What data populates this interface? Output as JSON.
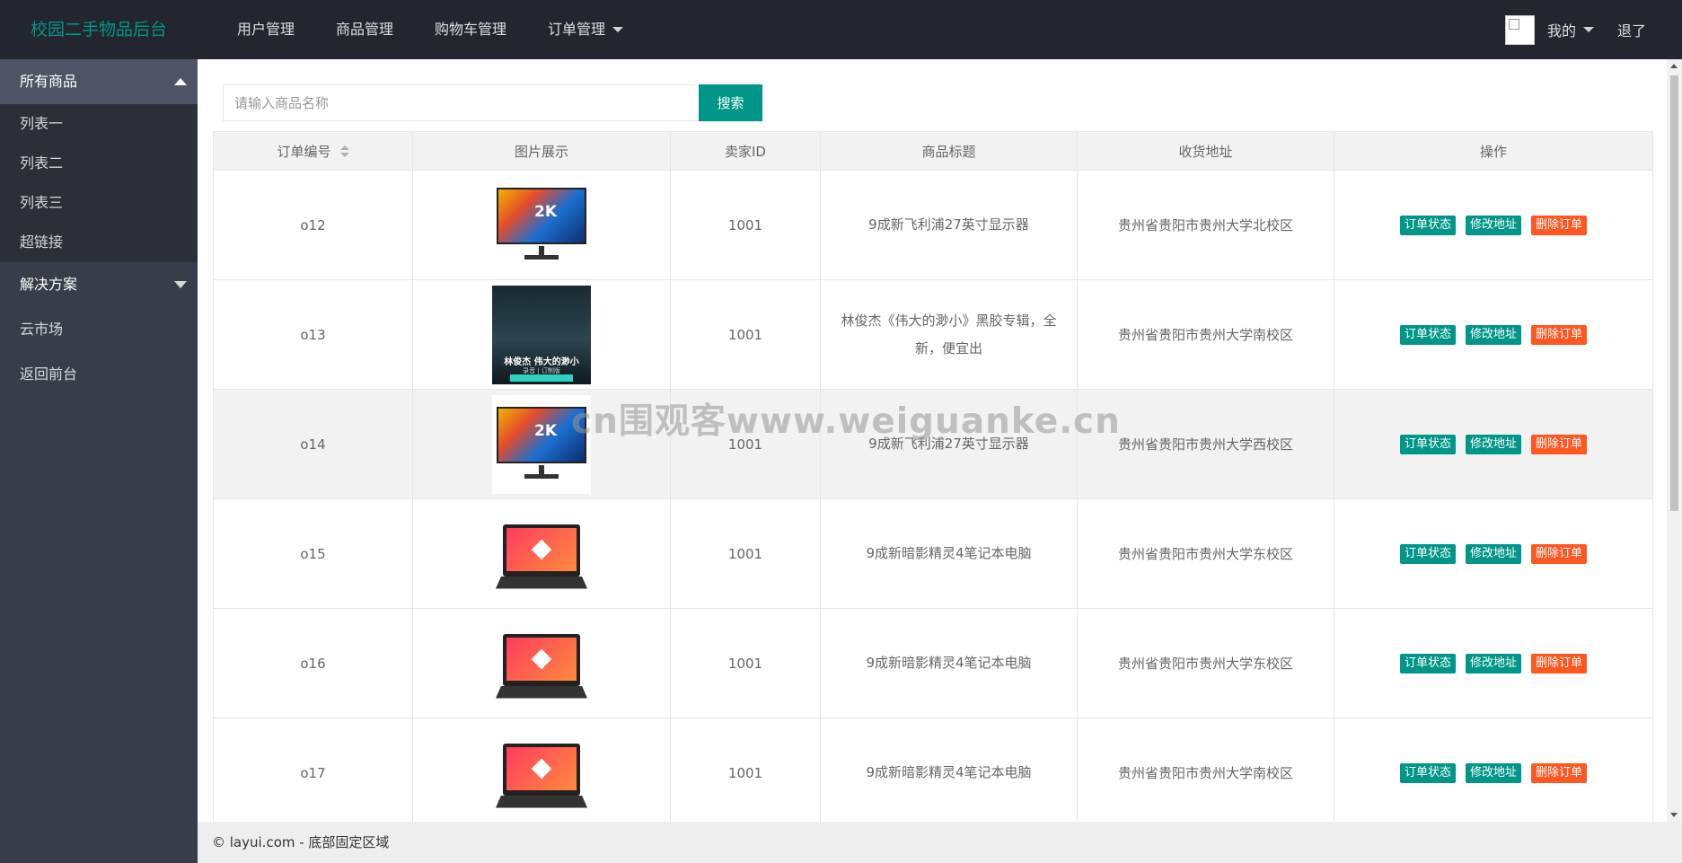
{
  "header": {
    "logo": "校园二手物品后台",
    "nav": [
      "用户管理",
      "商品管理",
      "购物车管理",
      "订单管理"
    ],
    "user_label": "我的",
    "logout_label": "退了"
  },
  "sidebar": {
    "group1_title": "所有商品",
    "group1_items": [
      "列表一",
      "列表二",
      "列表三",
      "超链接"
    ],
    "group2_title": "解决方案",
    "items": [
      "云市场",
      "返回前台"
    ]
  },
  "search": {
    "placeholder": "请输入商品名称",
    "button": "搜索"
  },
  "table": {
    "headers": [
      "订单编号",
      "图片展示",
      "卖家ID",
      "商品标题",
      "收货地址",
      "操作"
    ],
    "actions": [
      "订单状态",
      "修改地址",
      "删除订单"
    ],
    "rows": [
      {
        "id": "o12",
        "image": "monitor-image",
        "badge": "2K",
        "seller": "1001",
        "title": "9成新飞利浦27英寸显示器",
        "address": "贵州省贵阳市贵州大学北校区"
      },
      {
        "id": "o13",
        "image": "album-image",
        "album_title": "林俊杰 伟大的渺小",
        "album_sub": "录音 | 订制版",
        "seller": "1001",
        "title": "林俊杰《伟大的渺小》黑胶专辑，全新，便宜出",
        "address": "贵州省贵阳市贵州大学南校区"
      },
      {
        "id": "o14",
        "image": "monitor-image",
        "badge": "2K",
        "seller": "1001",
        "title": "9成新飞利浦27英寸显示器",
        "address": "贵州省贵阳市贵州大学西校区"
      },
      {
        "id": "o15",
        "image": "laptop-image",
        "seller": "1001",
        "title": "9成新暗影精灵4笔记本电脑",
        "address": "贵州省贵阳市贵州大学东校区"
      },
      {
        "id": "o16",
        "image": "laptop-image",
        "seller": "1001",
        "title": "9成新暗影精灵4笔记本电脑",
        "address": "贵州省贵阳市贵州大学东校区"
      },
      {
        "id": "o17",
        "image": "laptop-image",
        "seller": "1001",
        "title": "9成新暗影精灵4笔记本电脑",
        "address": "贵州省贵阳市贵州大学南校区"
      }
    ]
  },
  "watermark": "cn围观客www.weiguanke.cn",
  "footer": "© layui.com - 底部固定区域",
  "colors": {
    "primary": "#009688",
    "danger": "#ff5722",
    "header_bg": "#23262e",
    "sidebar_bg": "#393d49"
  }
}
